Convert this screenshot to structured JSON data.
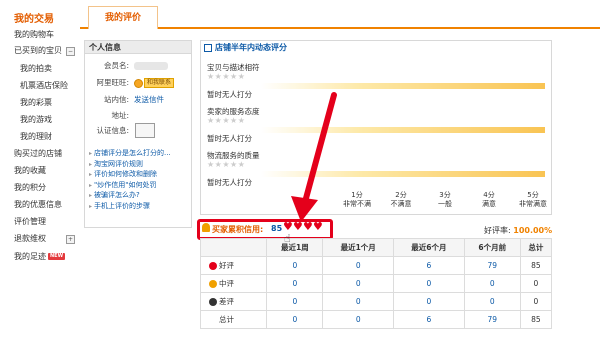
{
  "sidebar": {
    "title": "我的交易",
    "items": [
      {
        "label": "我的购物车"
      },
      {
        "label": "已买到的宝贝"
      },
      {
        "label": "我的拍卖"
      },
      {
        "label": "机票酒店保险"
      },
      {
        "label": "我的彩票"
      },
      {
        "label": "我的游戏"
      },
      {
        "label": "我的理财"
      },
      {
        "label": "购买过的店铺"
      },
      {
        "label": "我的收藏"
      },
      {
        "label": "我的积分"
      },
      {
        "label": "我的优惠信息"
      },
      {
        "label": "评价管理"
      },
      {
        "label": "退款维权"
      },
      {
        "label": "我的足迹"
      }
    ],
    "new_badge": "NEW"
  },
  "tab": {
    "label": "我的评价"
  },
  "personal_info": {
    "header": "个人信息",
    "member_label": "会员名:",
    "wangwang_label": "阿里旺旺:",
    "wangwang_badge": "和我联系",
    "letter_label": "站内信:",
    "letter_link": "发送信件",
    "address_label": "地址:",
    "cert_label": "认证信息:",
    "links": [
      "店铺评分是怎么打分的...",
      "淘宝网评价规则",
      "评价如何修改和删除",
      "\"炒作信用\"如何处罚",
      "被骗评怎么办?",
      "手机上评价的步骤"
    ]
  },
  "rating": {
    "header": "店铺半年内动态评分",
    "items": [
      {
        "title": "宝贝与描述相符",
        "none": "暂时无人打分"
      },
      {
        "title": "卖家的服务态度",
        "none": "暂时无人打分"
      },
      {
        "title": "物流服务的质量",
        "none": "暂时无人打分"
      }
    ],
    "scale": [
      {
        "score": "1分",
        "label": "非常不满"
      },
      {
        "score": "2分",
        "label": "不满意"
      },
      {
        "score": "3分",
        "label": "一般"
      },
      {
        "score": "4分",
        "label": "满意"
      },
      {
        "score": "5分",
        "label": "非常满意"
      }
    ],
    "stars": "★★★★★"
  },
  "credit": {
    "label": "买家累积信用:",
    "value": "85",
    "good_rate_label": "好评率:",
    "good_rate_value": "100.00%"
  },
  "table": {
    "headers": [
      "",
      "最近1周",
      "最近1个月",
      "最近6个月",
      "6个月前",
      "总计"
    ],
    "rows": [
      {
        "label": "好评",
        "values": [
          "0",
          "0",
          "6",
          "79",
          "85"
        ]
      },
      {
        "label": "中评",
        "values": [
          "0",
          "0",
          "0",
          "0",
          "0"
        ]
      },
      {
        "label": "差评",
        "values": [
          "0",
          "0",
          "0",
          "0",
          "0"
        ]
      },
      {
        "label": "总计",
        "values": [
          "0",
          "0",
          "6",
          "79",
          "85"
        ]
      }
    ]
  },
  "colors": {
    "accent": "#f08200",
    "link": "#0d5aa7",
    "annotation": "#e4001b"
  }
}
